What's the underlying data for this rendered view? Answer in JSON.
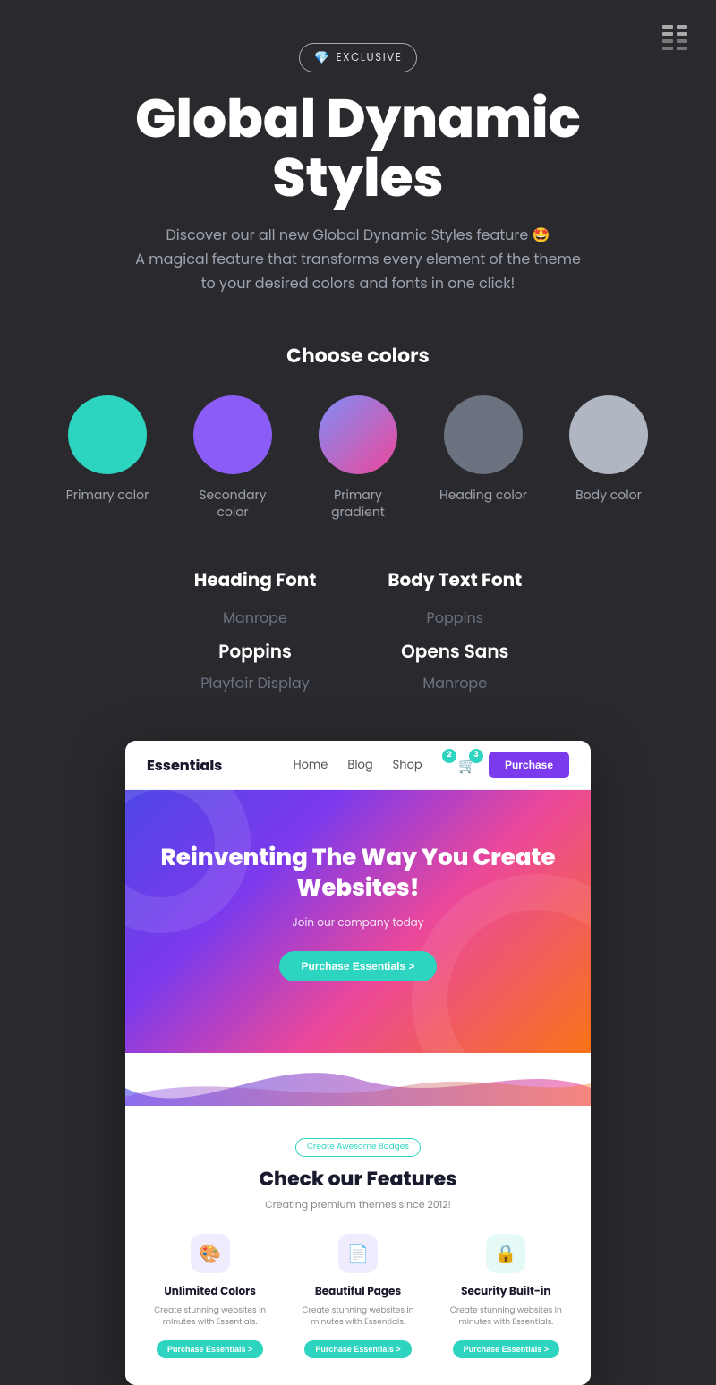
{
  "topLogo": {
    "label": "Theme Logo"
  },
  "badge": {
    "icon": "💎",
    "text": "EXCLUSIVE"
  },
  "header": {
    "title": "Global Dynamic Styles",
    "subtitle1": "Discover our all new Global Dynamic Styles feature 🤩",
    "subtitle2": "A magical feature that transforms every element of the theme",
    "subtitle3": "to your desired colors and fonts in one click!"
  },
  "colors": {
    "title": "Choose colors",
    "items": [
      {
        "label": "Primary color",
        "type": "primary"
      },
      {
        "label": "Secondary color",
        "type": "secondary"
      },
      {
        "label": "Primary gradient",
        "type": "gradient"
      },
      {
        "label": "Heading color",
        "type": "heading"
      },
      {
        "label": "Body color",
        "type": "body"
      }
    ]
  },
  "fonts": {
    "heading": {
      "title": "Heading Font",
      "options": [
        "Manrope",
        "Poppins",
        "Playfair Display"
      ],
      "active": "Poppins"
    },
    "body": {
      "title": "Body Text Font",
      "options": [
        "Poppins",
        "Opens Sans",
        "Manrope"
      ],
      "active": "Opens Sans"
    }
  },
  "preview": {
    "nav": {
      "logo": "Essentials",
      "links": [
        "Home",
        "Blog",
        "Shop"
      ],
      "cartCount": "3",
      "wishlistCount": "2",
      "purchaseBtn": "Purchase"
    },
    "hero": {
      "title": "Reinventing The Way You Create Websites!",
      "subtitle": "Join our company today",
      "btn": "Purchase Essentials >"
    },
    "features": {
      "badge": "Create Awesome Badges",
      "title": "Check our Features",
      "subtitle": "Creating premium themes since 2012!",
      "items": [
        {
          "icon": "🎨",
          "iconClass": "feature-icon-purple",
          "name": "Unlimited Colors",
          "desc": "Create stunning websites in minutes with Essentials.",
          "btn": "Purchase Essentials >"
        },
        {
          "icon": "📄",
          "iconClass": "feature-icon-lavender",
          "name": "Beautiful Pages",
          "desc": "Create stunning websites in minutes with Essentials.",
          "btn": "Purchase Essentials >"
        },
        {
          "icon": "🔒",
          "iconClass": "feature-icon-teal",
          "name": "Security Built-in",
          "desc": "Create stunning websites in minutes with Essentials.",
          "btn": "Purchase Essentials >"
        }
      ]
    }
  }
}
